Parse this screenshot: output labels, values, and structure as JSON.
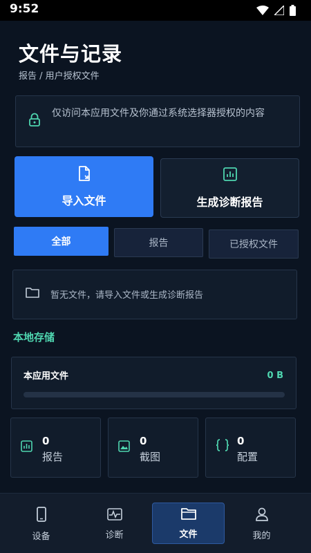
{
  "status_bar": {
    "time": "9:52"
  },
  "header": {
    "title": "文件与记录",
    "breadcrumb": "报告 / 用户授权文件"
  },
  "notice": {
    "icon": "lock-icon",
    "text": "仅访问本应用文件及你通过系统选择器授权的内容"
  },
  "actions": {
    "import_label": "导入文件",
    "import_icon": "file-import-icon",
    "diagnose_label": "生成诊断报告",
    "diagnose_icon": "report-chart-icon"
  },
  "filter_tabs": [
    {
      "label": "全部",
      "selected": true
    },
    {
      "label": "报告",
      "selected": false
    },
    {
      "label": "已授权文件",
      "selected": false
    }
  ],
  "empty_state": {
    "icon": "folder-icon",
    "text": "暂无文件，请导入文件或生成诊断报告"
  },
  "local_storage": {
    "section_title": "本地存储",
    "app_files_label": "本应用文件",
    "size": "0 B",
    "usage_fraction": 0
  },
  "stats": [
    {
      "icon": "report-icon",
      "count": "0",
      "label": "报告"
    },
    {
      "icon": "image-icon",
      "count": "0",
      "label": "截图"
    },
    {
      "icon": "code-braces-icon",
      "count": "0",
      "label": "配置"
    }
  ],
  "bottom_nav": [
    {
      "icon": "phone-icon",
      "label": "设备",
      "active": false
    },
    {
      "icon": "pulse-icon",
      "label": "诊断",
      "active": false
    },
    {
      "icon": "folder-icon",
      "label": "文件",
      "active": true
    },
    {
      "icon": "person-icon",
      "label": "我的",
      "active": false
    }
  ],
  "colors": {
    "background": "#0b1421",
    "primary": "#2f7bf5",
    "accent": "#4fd6b0",
    "card": "#111c2b"
  }
}
